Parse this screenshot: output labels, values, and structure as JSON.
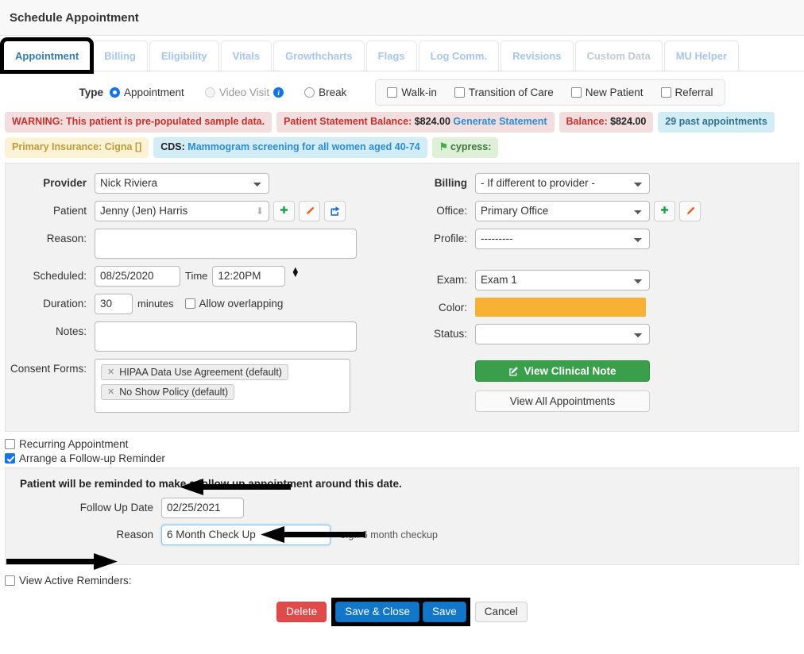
{
  "header": {
    "title": "Schedule Appointment"
  },
  "tabs": [
    {
      "label": "Appointment",
      "state": "active"
    },
    {
      "label": "Billing",
      "state": "normal"
    },
    {
      "label": "Eligibility",
      "state": "normal"
    },
    {
      "label": "Vitals",
      "state": "normal"
    },
    {
      "label": "Growthcharts",
      "state": "normal"
    },
    {
      "label": "Flags",
      "state": "normal"
    },
    {
      "label": "Log Comm.",
      "state": "normal"
    },
    {
      "label": "Revisions",
      "state": "normal"
    },
    {
      "label": "Custom Data",
      "state": "dim"
    },
    {
      "label": "MU Helper",
      "state": "normal"
    }
  ],
  "type_row": {
    "label": "Type",
    "radios": [
      {
        "label": "Appointment",
        "checked": true,
        "disabled": false
      },
      {
        "label": "Video Visit",
        "checked": false,
        "disabled": true,
        "info_icon": "info-circle-icon"
      },
      {
        "label": "Break",
        "checked": false,
        "disabled": false
      }
    ],
    "checkboxes": [
      {
        "label": "Walk-in",
        "checked": false
      },
      {
        "label": "Transition of Care",
        "checked": false
      },
      {
        "label": "New Patient",
        "checked": false
      },
      {
        "label": "Referral",
        "checked": false
      }
    ]
  },
  "badges": {
    "row1": [
      {
        "kind": "danger",
        "text": "WARNING: This patient is pre-populated sample data."
      },
      {
        "kind": "danger",
        "text_prefix": "Patient Statement Balance: ",
        "amount": "$824.00",
        "link": "Generate Statement"
      },
      {
        "kind": "danger",
        "text_prefix": "Balance: ",
        "amount": "$824.00"
      },
      {
        "kind": "info",
        "text": "29 past appointments"
      }
    ],
    "row2": [
      {
        "kind": "warn",
        "text": "Primary Insurance: Cigna []"
      },
      {
        "kind": "info",
        "text_prefix": "CDS: ",
        "link": "Mammogram screening for all women aged 40-74"
      },
      {
        "kind": "success",
        "icon": "flag-icon",
        "text": "cypress:"
      }
    ]
  },
  "form_left": {
    "provider": {
      "label": "Provider",
      "value": "Nick Riviera"
    },
    "patient": {
      "label": "Patient",
      "value": "Jenny (Jen) Harris",
      "buttons": [
        {
          "icon": "plus-icon",
          "name": "add-patient-button"
        },
        {
          "icon": "pencil-icon",
          "name": "edit-patient-button"
        },
        {
          "icon": "share-icon",
          "name": "open-patient-button"
        }
      ]
    },
    "reason": {
      "label": "Reason:",
      "value": ""
    },
    "scheduled": {
      "label": "Scheduled:",
      "date": "08/25/2020",
      "time_label": "Time",
      "time": "12:20PM"
    },
    "duration": {
      "label": "Duration:",
      "value": "30",
      "unit": "minutes",
      "allow_overlapping_label": "Allow overlapping",
      "allow_overlapping": false
    },
    "notes": {
      "label": "Notes:",
      "value": ""
    },
    "consent": {
      "label": "Consent Forms:",
      "chips": [
        "HIPAA Data Use Agreement (default)",
        "No Show Policy (default)"
      ]
    }
  },
  "form_right": {
    "billing": {
      "label": "Billing",
      "value": "- If different to provider -"
    },
    "office": {
      "label": "Office:",
      "value": "Primary Office",
      "buttons": [
        {
          "icon": "plus-icon",
          "name": "add-office-button"
        },
        {
          "icon": "pencil-icon",
          "name": "edit-office-button"
        }
      ]
    },
    "profile": {
      "label": "Profile:",
      "value": "---------"
    },
    "exam": {
      "label": "Exam:",
      "value": "Exam 1"
    },
    "color": {
      "label": "Color:",
      "value": "#f8b133"
    },
    "status": {
      "label": "Status:",
      "value": ""
    },
    "view_clinical_note": "View Clinical Note",
    "view_all_appointments": "View All Appointments"
  },
  "options": {
    "recurring": {
      "label": "Recurring Appointment",
      "checked": false
    },
    "followup": {
      "label": "Arrange a Follow-up Reminder",
      "checked": true
    }
  },
  "followup_panel": {
    "note": "Patient will be reminded to make a follow up appointment around this date.",
    "date_label": "Follow Up Date",
    "date_value": "02/25/2021",
    "reason_label": "Reason",
    "reason_value": "6 Month Check Up",
    "hint": "e.g.: 6 month checkup"
  },
  "view_active_reminders": {
    "label": "View Active Reminders:",
    "checked": false
  },
  "footer": {
    "delete": "Delete",
    "save_and_close": "Save & Close",
    "save": "Save",
    "cancel": "Cancel"
  },
  "colors": {
    "accent_blue": "#1277c8",
    "danger_red": "#e04a4a",
    "success_green": "#3a9f4a",
    "appointment_color": "#f8b133"
  }
}
